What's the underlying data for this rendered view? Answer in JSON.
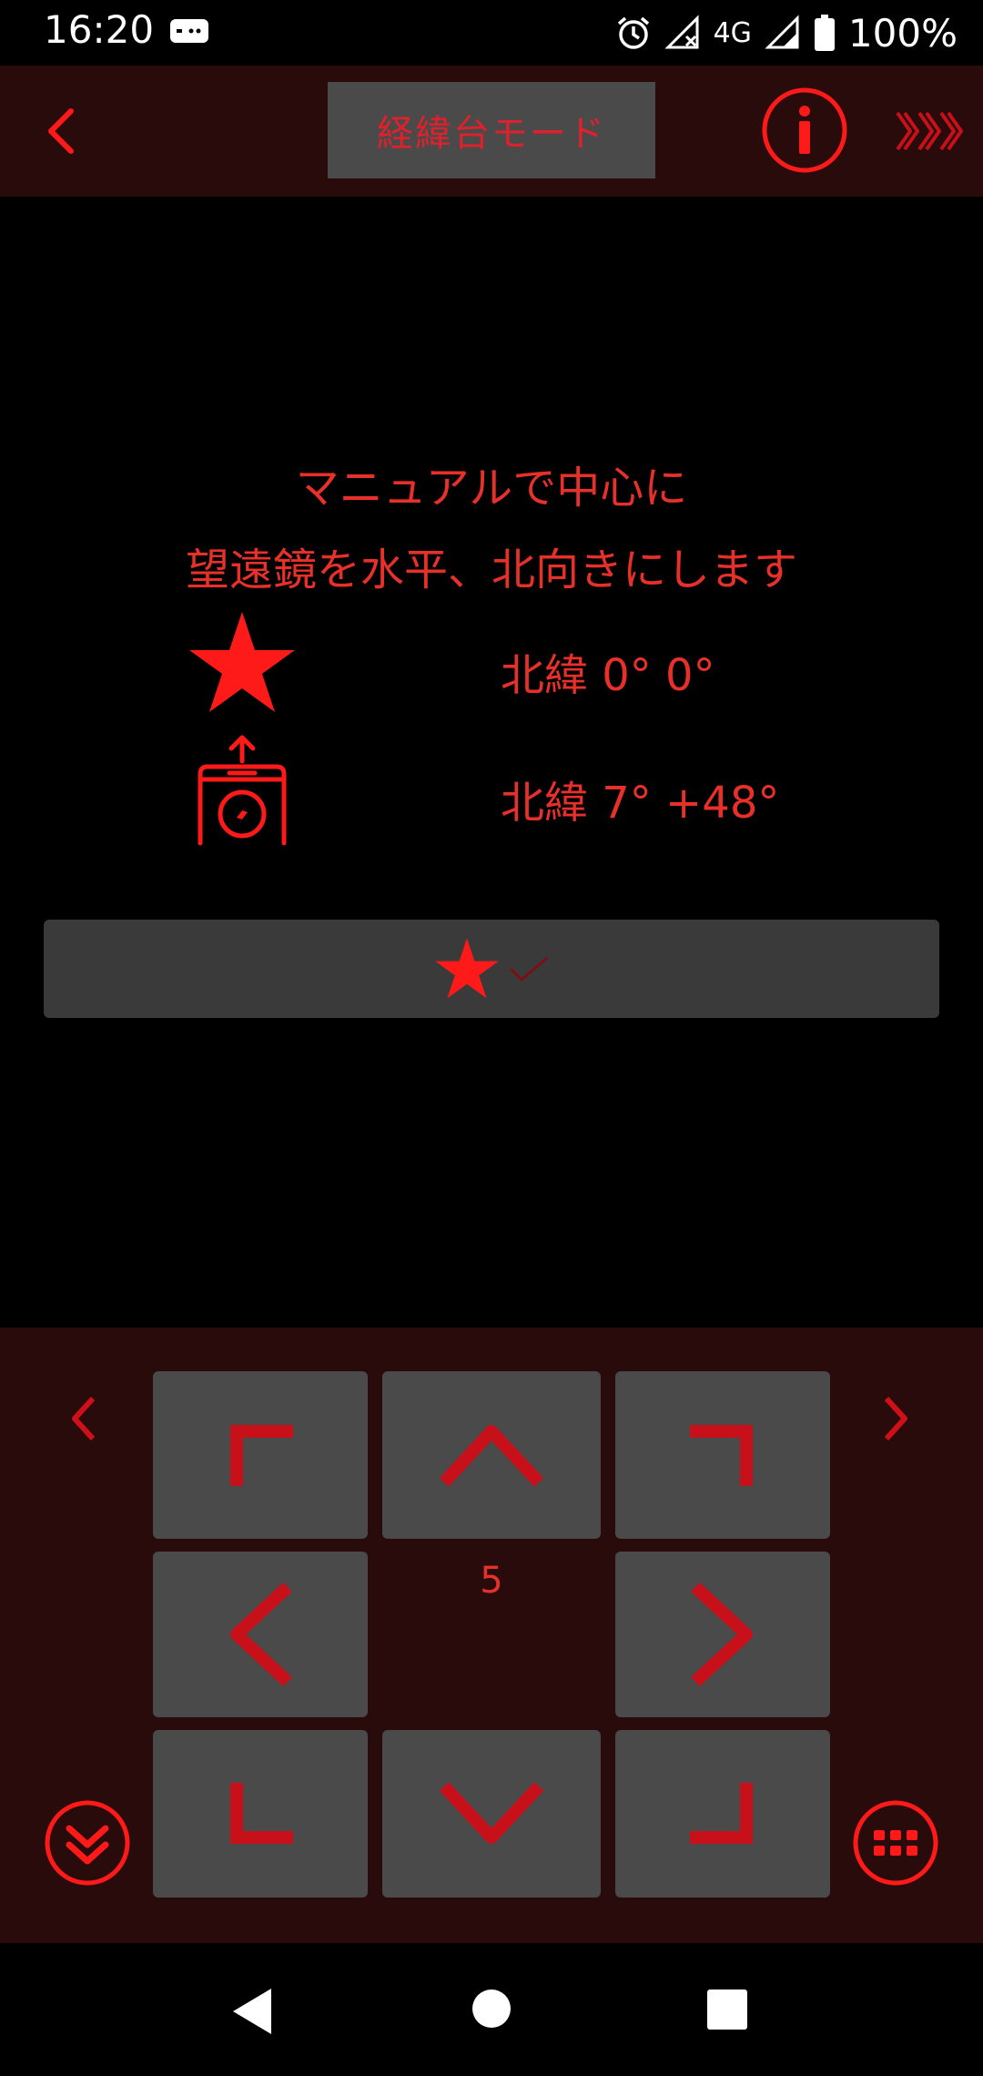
{
  "status_bar": {
    "time": "16:20",
    "network": "4G",
    "battery": "100%"
  },
  "top_bar": {
    "mode_label": "経緯台モード",
    "icons": {
      "back": "chevron-left-icon",
      "info": "info-icon",
      "more": "triple-chevron-right-icon"
    }
  },
  "main": {
    "instruction_line1": "マニュアルで中心に",
    "instruction_line2": "望遠鏡を水平、北向きにします",
    "star_coords": "北緯 0°  0°",
    "device_coords": "北緯 7° +48°",
    "confirm_icons": [
      "star-icon",
      "check-icon"
    ]
  },
  "control_panel": {
    "speed": "5",
    "pads": [
      "up-left",
      "up",
      "up-right",
      "left",
      "right",
      "down-left",
      "down",
      "down-right"
    ]
  },
  "colors": {
    "accent": "#ff1a1a",
    "text_red": "#e8302a",
    "bar_bg": "#2a0b0c",
    "button_bg": "#4a4a4a",
    "background": "#000000"
  }
}
